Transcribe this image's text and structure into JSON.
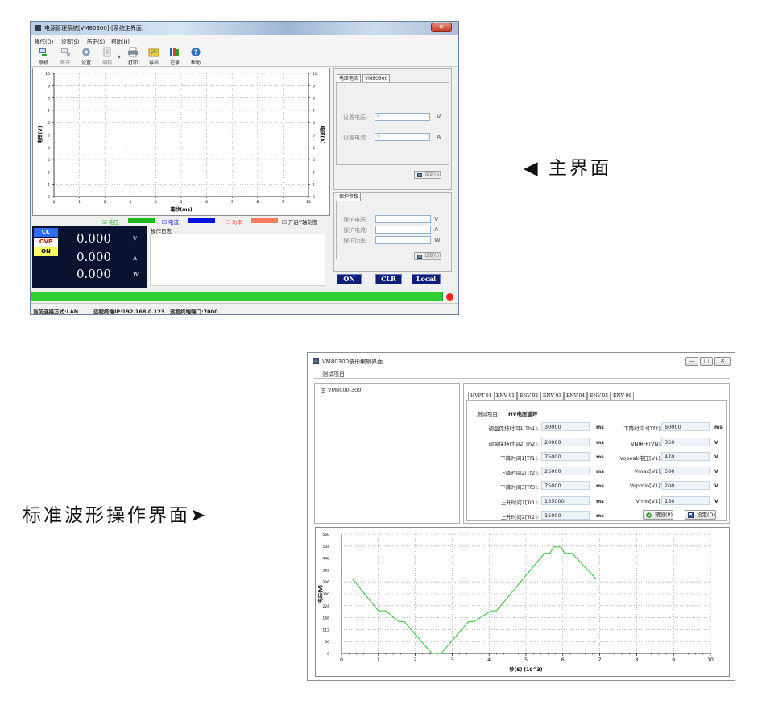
{
  "colors": {
    "voltage": "#1fb81f",
    "current": "#0010e0",
    "power": "#ff7a5c",
    "navy": "#0e1f7a",
    "grid": "#000000",
    "wave": "#2ec02e"
  },
  "window1": {
    "title": "电源管理系统[VM80300]-[系统主界面]",
    "close_glyph": "✕",
    "menu": [
      "操作(O)",
      "设置(S)",
      "历史(S)",
      "帮助(H)"
    ],
    "toolbar": [
      {
        "label": "联机",
        "icon": "connect-icon"
      },
      {
        "label": "断开",
        "icon": "disconnect-icon"
      },
      {
        "label": "设置",
        "icon": "gear-icon"
      },
      {
        "label": "编辑",
        "icon": "edit-icon"
      },
      {
        "label": "打印",
        "icon": "printer-icon"
      },
      {
        "label": "导出",
        "icon": "export-icon"
      },
      {
        "label": "记录",
        "icon": "records-icon"
      },
      {
        "label": "帮助",
        "icon": "help-icon"
      }
    ],
    "toolbar_sep": "▾",
    "chart": {
      "y_left_label": "电压(V)",
      "y_right_label": "电流(A)",
      "x_label": "毫秒(ms)",
      "y_ticks": [
        "0",
        "1",
        "2",
        "3",
        "4",
        "5",
        "6",
        "7",
        "8",
        "9",
        "10"
      ],
      "x_ticks": [
        "0",
        "1",
        "2",
        "3",
        "4",
        "5",
        "6",
        "7",
        "8",
        "9",
        "10"
      ]
    },
    "legend": {
      "voltage": "☑ 电压",
      "current": "☑ 电流",
      "power": "☐ 功率",
      "auxgrid": "☑ 开启Y轴刻度"
    },
    "readout": {
      "badges": [
        "CC",
        "OVP",
        "ON"
      ],
      "voltage": "0.000",
      "voltage_unit": "V",
      "current": "0.000",
      "current_unit": "A",
      "power": "0.000",
      "power_unit": "W"
    },
    "oplog_title": "操作日志",
    "vc_panel": {
      "tabs": [
        "电压电流",
        "VM80300"
      ],
      "set_voltage_label": "设置电压:",
      "set_voltage_value": "0",
      "set_voltage_unit": "V",
      "set_current_label": "设置电流:",
      "set_current_value": "0",
      "set_current_unit": "A",
      "set_button": "设定(S)"
    },
    "protect_panel": {
      "tab": "保护参数",
      "ov_label": "保护电压:",
      "ov_unit": "V",
      "oc_label": "保护电流:",
      "oc_unit": "A",
      "op_label": "保护功率:",
      "op_unit": "W",
      "set_button": "设定(S)"
    },
    "buttons": {
      "on": "ON",
      "clr": "CLR",
      "local": "Local"
    },
    "progress": 1.0,
    "status": {
      "conn": "当前连接方式:LAN",
      "ip": "远程终端IP:192.168.0.123",
      "port": "远程终端端口:7000"
    }
  },
  "captions": {
    "main": "◀ 主界面",
    "wave": "标准波形操作界面➤"
  },
  "window2": {
    "title": "VM80300波形编辑界面",
    "min_glyph": "—",
    "max_glyph": "▢",
    "close_glyph": "✕",
    "menu": "测试项目",
    "tree": {
      "expander": "+",
      "node": "VM8000-300"
    },
    "tabs": [
      "HVPT-01",
      "ENV-01",
      "ENV-02",
      "ENV-03",
      "ENV-04",
      "ENV-05",
      "ENV-06"
    ],
    "test_item_label": "测试项目:",
    "test_item_value": "HV电压循环",
    "left_params": [
      {
        "label": "调温保持时间1[Th1]:",
        "value": "30000",
        "unit": "ms"
      },
      {
        "label": "调温保持时间2[Th2]:",
        "value": "20000",
        "unit": "ms"
      },
      {
        "label": "下降时间1[Tf1]:",
        "value": "75000",
        "unit": "ms"
      },
      {
        "label": "下降时间2[Tf2]:",
        "value": "25000",
        "unit": "ms"
      },
      {
        "label": "下降时间3[Tf3]:",
        "value": "75000",
        "unit": "ms"
      },
      {
        "label": "上升时间1[Tr1]:",
        "value": "135000",
        "unit": "ms"
      },
      {
        "label": "上升时间2[Tr2]:",
        "value": "15000",
        "unit": "ms"
      }
    ],
    "right_params": [
      {
        "label": "下降时间4[Tf4]:",
        "value": "60000",
        "unit": "ms"
      },
      {
        "label": "VN电压[VN]:",
        "value": "350",
        "unit": "V"
      },
      {
        "label": "Vopeak电压[V1]:",
        "value": "470",
        "unit": "V"
      },
      {
        "label": "Vmax[V1]:",
        "value": "500",
        "unit": "V"
      },
      {
        "label": "Vopmin[V1]:",
        "value": "200",
        "unit": "V"
      },
      {
        "label": "Vmin[V1]:",
        "value": "150",
        "unit": "V"
      }
    ],
    "preview_button": "预览(P)",
    "set_button": "设定(D)"
  },
  "chart_data": {
    "type": "line",
    "xlabel": "秒(S) (10^3)",
    "ylabel": "电压(V)",
    "x_ticks": [
      "0",
      "1",
      "2",
      "3",
      "4",
      "5",
      "6",
      "7",
      "8",
      "9",
      "10"
    ],
    "y_ticks": [
      "0",
      "56",
      "112",
      "168",
      "224",
      "280",
      "336",
      "392",
      "448",
      "504",
      "560"
    ],
    "xlim": [
      0,
      10
    ],
    "ylim": [
      0,
      560
    ],
    "grid": true,
    "series": [
      {
        "x": [
          0,
          0.3,
          1.0,
          1.2,
          1.55,
          1.7,
          2.45,
          2.7,
          3.45,
          3.6,
          4.05,
          4.2,
          5.5,
          5.65,
          5.75,
          5.95,
          6.05,
          6.25,
          6.9,
          7.05
        ],
        "y": [
          350,
          350,
          200,
          200,
          150,
          150,
          0,
          0,
          150,
          150,
          200,
          200,
          470,
          470,
          500,
          500,
          470,
          470,
          350,
          350
        ]
      }
    ]
  }
}
